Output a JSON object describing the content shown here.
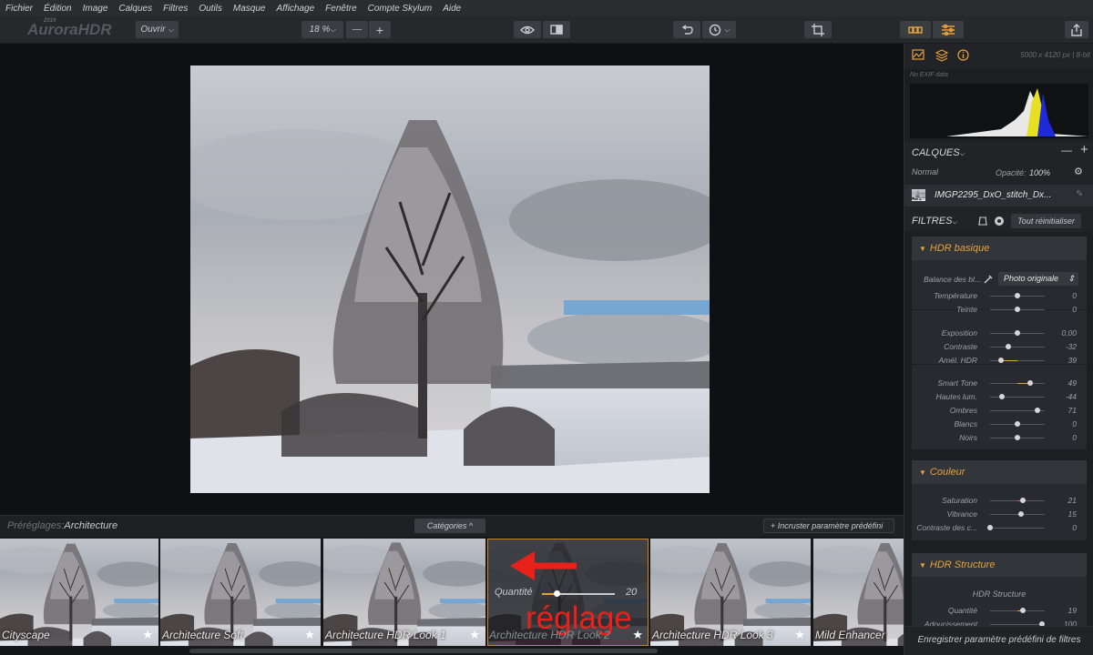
{
  "menu": [
    "Fichier",
    "Édition",
    "Image",
    "Calques",
    "Filtres",
    "Outils",
    "Masque",
    "Affichage",
    "Fenêtre",
    "Compte Skylum",
    "Aide"
  ],
  "app": {
    "name": "AuroraHDR",
    "year": "2019"
  },
  "toolbar": {
    "open_label": "Ouvrir",
    "zoom": "18 %",
    "zoom_minus": "—",
    "zoom_plus": "+"
  },
  "info": {
    "dimensions": "5000 x 4120 px | 8-bit",
    "exif": "No EXIF data"
  },
  "layers": {
    "title": "CALQUES",
    "blend": "Normal",
    "opacity_label": "Opacité:",
    "opacity_value": "100%",
    "layer_name": "IMGP2295_DxO_stitch_Dx...",
    "minus": "—",
    "plus": "+"
  },
  "filters": {
    "title": "FILTRES",
    "reset_label": "Tout réinitialiser"
  },
  "hdr_basic": {
    "title": "HDR basique",
    "wb_label": "Balance des bl...",
    "wb_value": "Photo originale",
    "rows": [
      {
        "name": "Température",
        "value": "0",
        "pct": 0.5,
        "color": "#4a8fd8"
      },
      {
        "name": "Teinte",
        "value": "0",
        "pct": 0.5,
        "color": "#47b857"
      },
      {
        "name": "Exposition",
        "value": "0,00",
        "pct": 0.5,
        "color": ""
      },
      {
        "name": "Contraste",
        "value": "-32",
        "pct": 0.34,
        "color": ""
      },
      {
        "name": "Amél. HDR",
        "value": "39",
        "pct": 0.2,
        "color": "#e6a23c"
      },
      {
        "name": "Smart Tone",
        "value": "49",
        "pct": 0.74,
        "color": "#e6a23c"
      },
      {
        "name": "Hautes lum.",
        "value": "-44",
        "pct": 0.22,
        "color": ""
      },
      {
        "name": "Ombres",
        "value": "71",
        "pct": 0.86,
        "color": ""
      },
      {
        "name": "Blancs",
        "value": "0",
        "pct": 0.5,
        "color": ""
      },
      {
        "name": "Noirs",
        "value": "0",
        "pct": 0.5,
        "color": ""
      }
    ]
  },
  "couleur": {
    "title": "Couleur",
    "rows": [
      {
        "name": "Saturation",
        "value": "21",
        "pct": 0.6,
        "color": "#c060c0"
      },
      {
        "name": "Vibrance",
        "value": "15",
        "pct": 0.57,
        "color": "#c060c0"
      },
      {
        "name": "Contraste des c...",
        "value": "0",
        "pct": 0.0,
        "color": ""
      }
    ]
  },
  "hdr_structure": {
    "title": "HDR Structure",
    "subtitle": "HDR Structure",
    "rows": [
      {
        "name": "Quantité",
        "value": "19",
        "pct": 0.6,
        "color": "#e6a23c"
      },
      {
        "name": "Adoucissement",
        "value": "100",
        "pct": 0.95,
        "color": ""
      }
    ]
  },
  "footer": {
    "save_preset": "Enregistrer paramètre prédéfini de filtres"
  },
  "presets": {
    "label_prefix": "Préréglages:",
    "category": "Architecture",
    "categories_btn": "Catégories",
    "incrust_btn": "+ Incruster paramètre prédéfini",
    "amount_label": "Quantité",
    "amount_value": "20",
    "amount_pct": 0.2,
    "annotation": "réglage",
    "star": "★",
    "items": [
      "Cityscape",
      "Architecture Soft",
      "Architecture HDR Look 1",
      "Architecture HDR Look 2",
      "Architecture HDR Look 3",
      "Mild Enhancer"
    ]
  },
  "colors": {
    "accent": "#e6a23c",
    "annotation_red": "#e8221b"
  }
}
